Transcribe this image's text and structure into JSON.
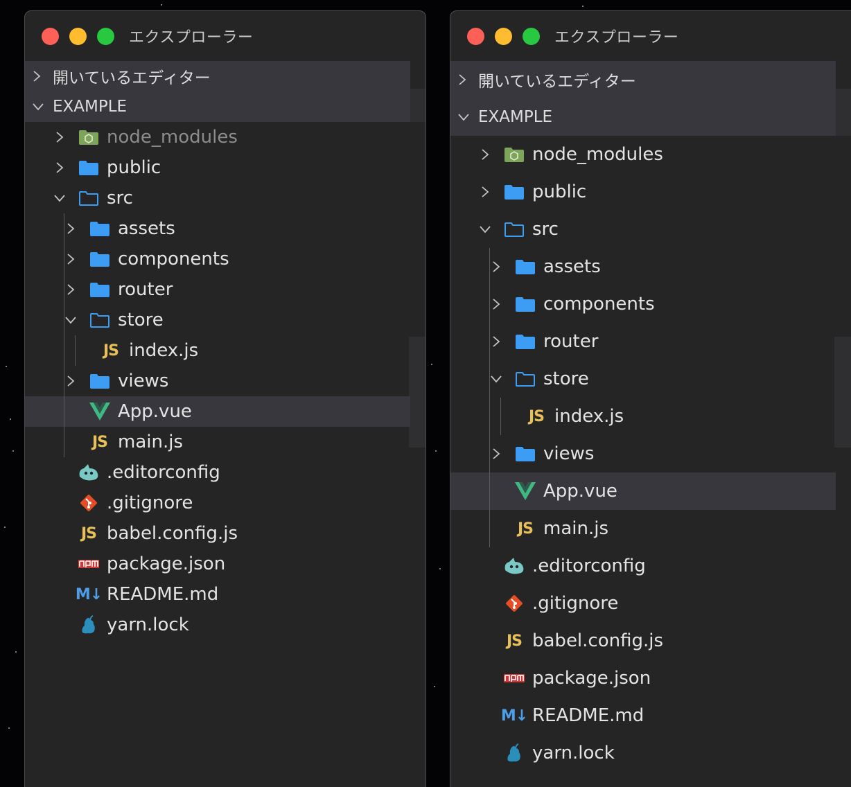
{
  "panels": [
    {
      "title": "エクスプローラー",
      "sections": {
        "open_editors": "開いているエディター",
        "project": "EXAMPLE"
      },
      "items": [
        {
          "label": "node_modules",
          "icon": "node-folder-icon",
          "chevron": "closed",
          "depth": 0
        },
        {
          "label": "public",
          "icon": "folder-icon",
          "chevron": "closed",
          "depth": 0
        },
        {
          "label": "src",
          "icon": "folder-open-icon",
          "chevron": "open",
          "depth": 0
        },
        {
          "label": "assets",
          "icon": "folder-icon",
          "chevron": "closed",
          "depth": 1
        },
        {
          "label": "components",
          "icon": "folder-icon",
          "chevron": "closed",
          "depth": 1
        },
        {
          "label": "router",
          "icon": "folder-icon",
          "chevron": "closed",
          "depth": 1
        },
        {
          "label": "store",
          "icon": "folder-open-icon",
          "chevron": "open",
          "depth": 1
        },
        {
          "label": "index.js",
          "icon": "js-icon",
          "chevron": "none",
          "depth": 2
        },
        {
          "label": "views",
          "icon": "folder-icon",
          "chevron": "closed",
          "depth": 1
        },
        {
          "label": "App.vue",
          "icon": "vue-icon",
          "chevron": "none",
          "depth": 1,
          "selected": true
        },
        {
          "label": "main.js",
          "icon": "js-icon",
          "chevron": "none",
          "depth": 1
        },
        {
          "label": ".editorconfig",
          "icon": "editorconfig-icon",
          "chevron": "none",
          "depth": 0
        },
        {
          "label": ".gitignore",
          "icon": "git-icon",
          "chevron": "none",
          "depth": 0
        },
        {
          "label": "babel.config.js",
          "icon": "js-icon",
          "chevron": "none",
          "depth": 0
        },
        {
          "label": "package.json",
          "icon": "npm-icon",
          "chevron": "none",
          "depth": 0
        },
        {
          "label": "README.md",
          "icon": "markdown-icon",
          "chevron": "none",
          "depth": 0
        },
        {
          "label": "yarn.lock",
          "icon": "yarn-icon",
          "chevron": "none",
          "depth": 0
        }
      ]
    },
    {
      "title": "エクスプローラー",
      "sections": {
        "open_editors": "開いているエディター",
        "project": "EXAMPLE"
      },
      "items": [
        {
          "label": "node_modules",
          "icon": "node-folder-icon",
          "chevron": "closed",
          "depth": 0
        },
        {
          "label": "public",
          "icon": "folder-icon",
          "chevron": "closed",
          "depth": 0
        },
        {
          "label": "src",
          "icon": "folder-open-icon",
          "chevron": "open",
          "depth": 0
        },
        {
          "label": "assets",
          "icon": "folder-icon",
          "chevron": "closed",
          "depth": 1
        },
        {
          "label": "components",
          "icon": "folder-icon",
          "chevron": "closed",
          "depth": 1
        },
        {
          "label": "router",
          "icon": "folder-icon",
          "chevron": "closed",
          "depth": 1
        },
        {
          "label": "store",
          "icon": "folder-open-icon",
          "chevron": "open",
          "depth": 1
        },
        {
          "label": "index.js",
          "icon": "js-icon",
          "chevron": "none",
          "depth": 2
        },
        {
          "label": "views",
          "icon": "folder-icon",
          "chevron": "closed",
          "depth": 1
        },
        {
          "label": "App.vue",
          "icon": "vue-icon",
          "chevron": "none",
          "depth": 1,
          "selected": true
        },
        {
          "label": "main.js",
          "icon": "js-icon",
          "chevron": "none",
          "depth": 1
        },
        {
          "label": ".editorconfig",
          "icon": "editorconfig-icon",
          "chevron": "none",
          "depth": 0
        },
        {
          "label": ".gitignore",
          "icon": "git-icon",
          "chevron": "none",
          "depth": 0
        },
        {
          "label": "babel.config.js",
          "icon": "js-icon",
          "chevron": "none",
          "depth": 0
        },
        {
          "label": "package.json",
          "icon": "npm-icon",
          "chevron": "none",
          "depth": 0
        },
        {
          "label": "README.md",
          "icon": "markdown-icon",
          "chevron": "none",
          "depth": 0
        },
        {
          "label": "yarn.lock",
          "icon": "yarn-icon",
          "chevron": "none",
          "depth": 0
        }
      ]
    }
  ],
  "colors": {
    "panel_bg": "#252526",
    "section_bg": "#37373d",
    "selected_bg": "#37373d",
    "text": "#e4e4e4",
    "dim_text": "#8c8c8c",
    "folder": "#3d9df5",
    "js": "#e8c05a",
    "vue": "#41b883",
    "git": "#e44d26",
    "npm": "#cb3837",
    "markdown": "#4d9ee6",
    "yarn": "#2c8ebb",
    "editorconfig": "#7ac9c6",
    "node": "#8cc84b"
  },
  "icons": {
    "chevron_closed": "chevron-right-icon",
    "chevron_open": "chevron-down-icon",
    "js_glyph": "JS",
    "markdown_glyph": "M↓"
  }
}
